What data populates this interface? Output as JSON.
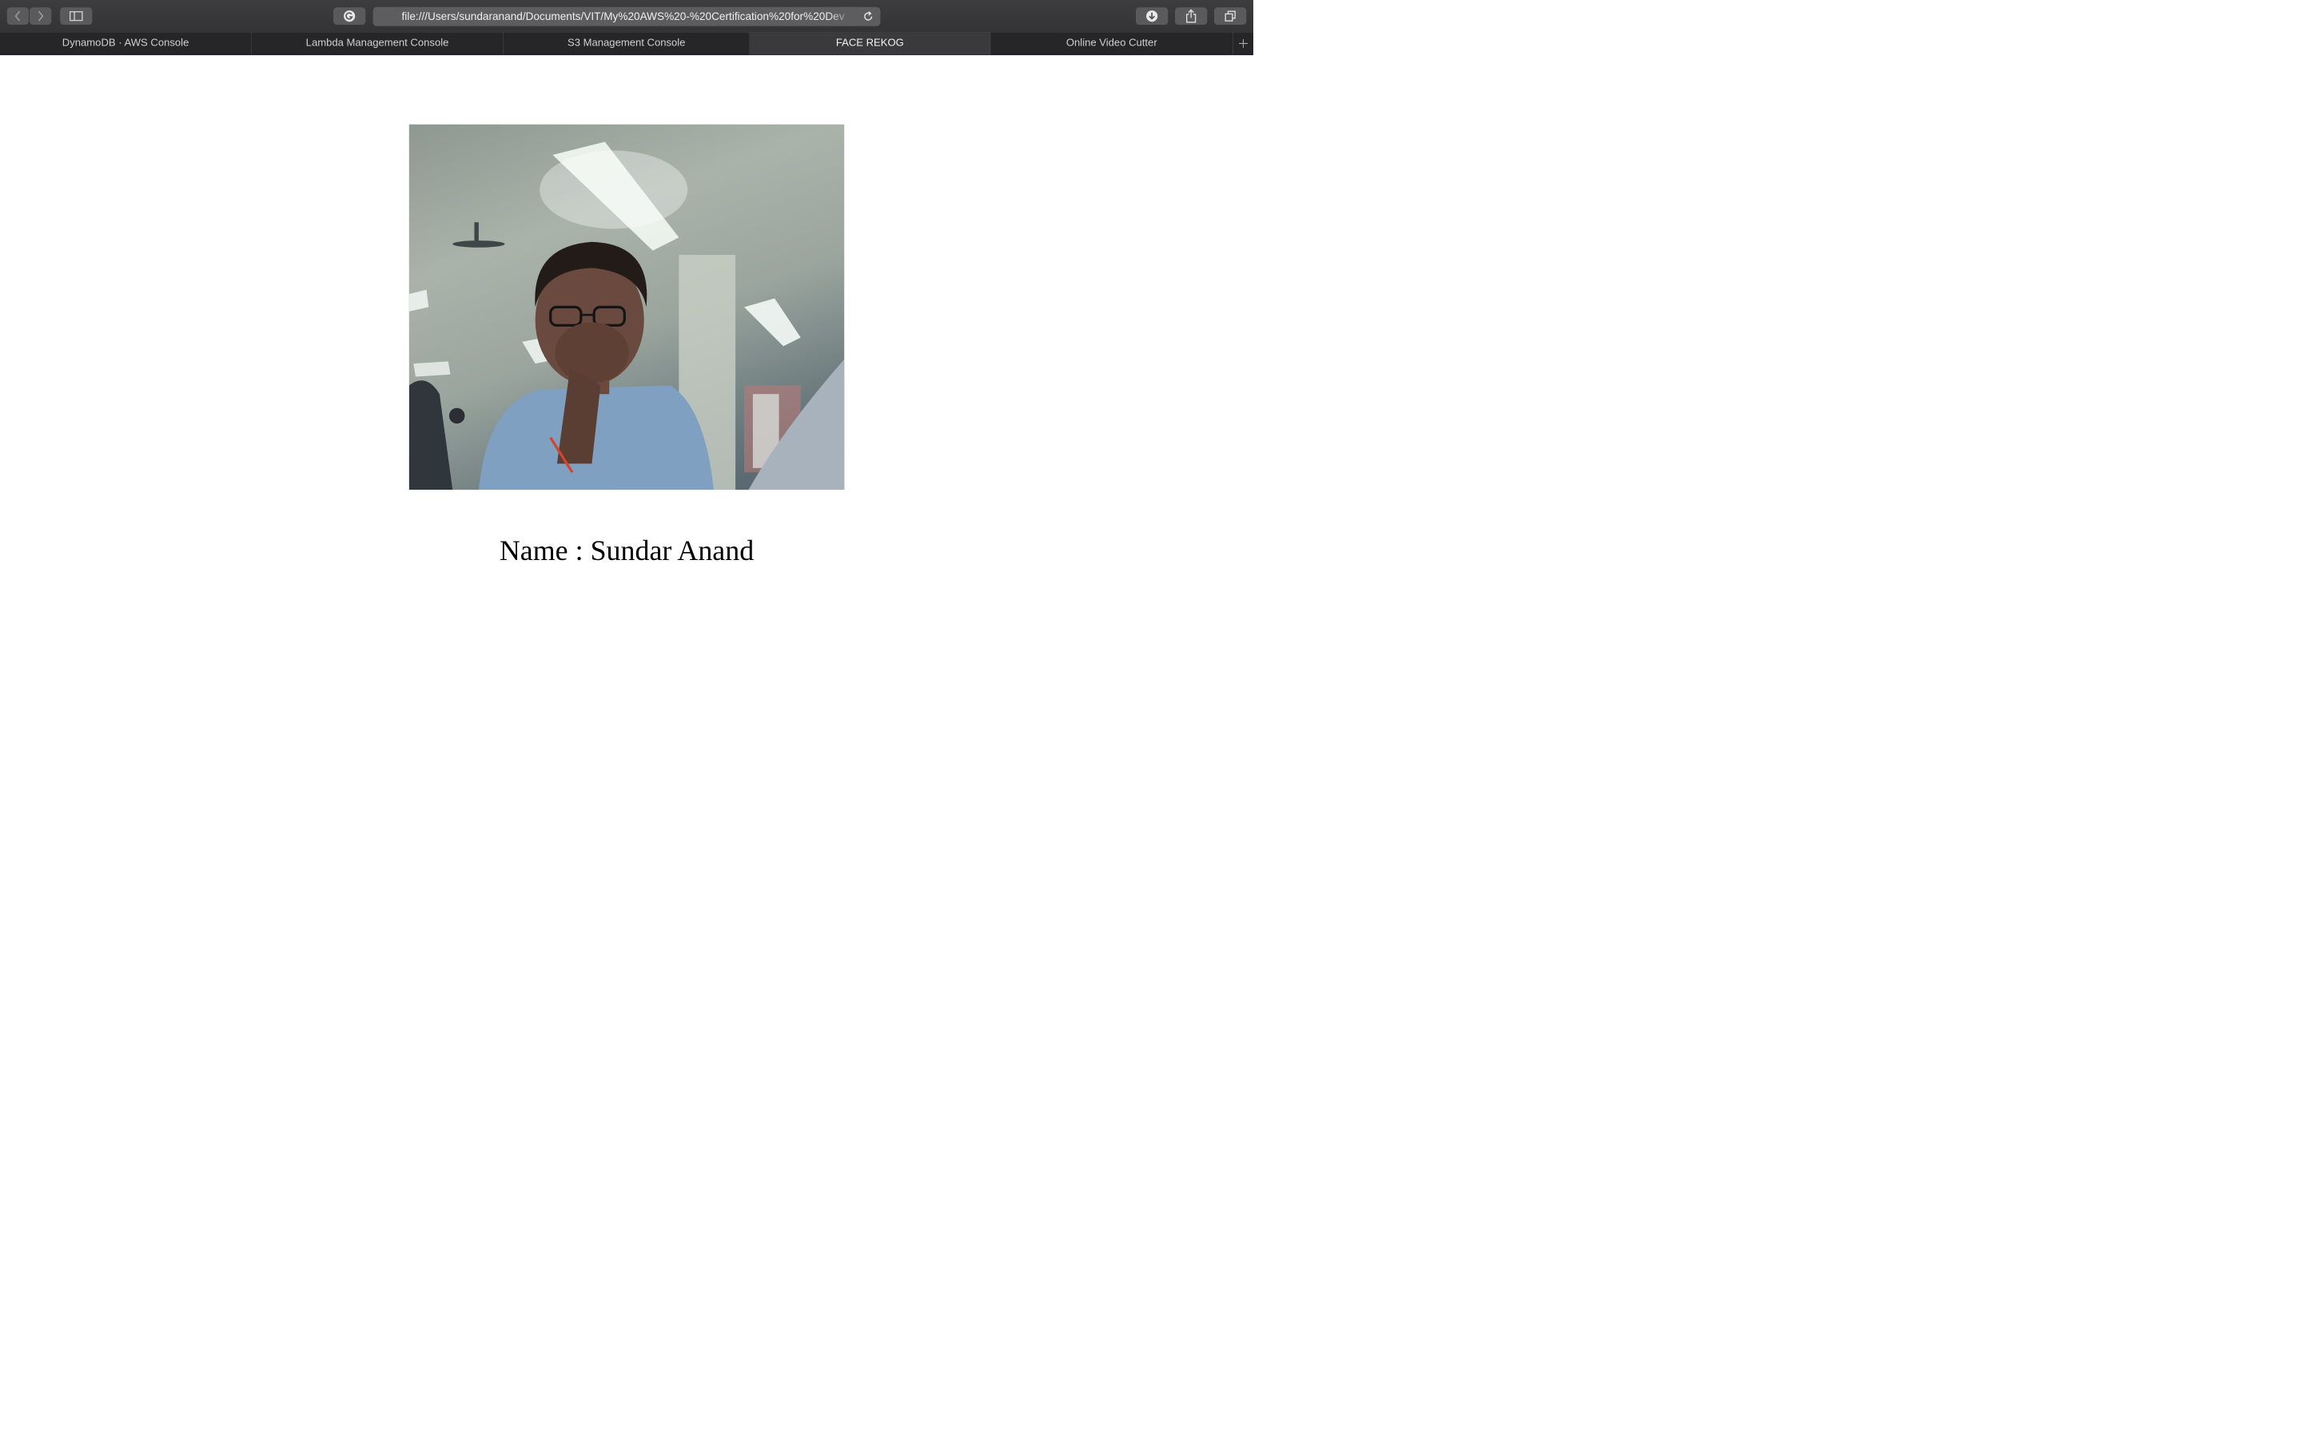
{
  "browser": {
    "url": "file:///Users/sundaranand/Documents/VIT/My%20AWS%20-%20Certification%20for%20Dev",
    "icons": {
      "back": "chevron-left-icon",
      "forward": "chevron-right-icon",
      "sidebar": "sidebar-icon",
      "extension": "grammarly-icon",
      "reload": "reload-icon",
      "downloads": "download-icon",
      "share": "share-icon",
      "tabs_overview": "tabs-overview-icon",
      "new_tab": "plus-icon"
    }
  },
  "tabs": [
    {
      "label": "DynamoDB · AWS Console",
      "active": false
    },
    {
      "label": "Lambda Management Console",
      "active": false
    },
    {
      "label": "S3 Management Console",
      "active": false
    },
    {
      "label": "FACE REKOG",
      "active": true
    },
    {
      "label": "Online Video Cutter",
      "active": false
    }
  ],
  "page": {
    "name_text": "Name : Sundar Anand"
  }
}
